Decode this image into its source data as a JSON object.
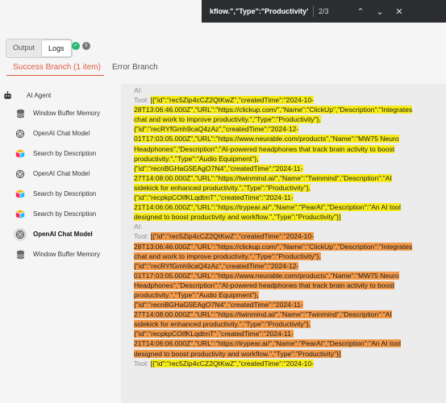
{
  "findbar": {
    "query": "kflow.\",\"Type\":\"Productivity\"}]",
    "count": "2/3",
    "prev_icon": "chevron-up-icon",
    "next_icon": "chevron-down-icon",
    "close_icon": "close-icon"
  },
  "toggle": {
    "output_label": "Output",
    "logs_label": "Logs"
  },
  "tabs": {
    "success_label": "Success Branch (1 item)",
    "error_label": "Error Branch"
  },
  "tree": {
    "root": "AI Agent",
    "items": [
      {
        "label": "Window Buffer Memory",
        "icon": "database-icon"
      },
      {
        "label": "OpenAI Chat Model",
        "icon": "openai-icon"
      },
      {
        "label": "Search by Description",
        "icon": "airtable-icon"
      },
      {
        "label": "OpenAI Chat Model",
        "icon": "openai-icon"
      },
      {
        "label": "Search by Description",
        "icon": "airtable-icon"
      },
      {
        "label": "Search by Description",
        "icon": "airtable-icon"
      },
      {
        "label": "OpenAI Chat Model",
        "icon": "openai-icon",
        "selected": true
      },
      {
        "label": "Window Buffer Memory",
        "icon": "database-icon"
      }
    ]
  },
  "log": {
    "blocks": [
      {
        "ai_label": "AI:",
        "tool_label": "Tool:",
        "lines": [
          "[{\"id\":\"rec5Zip4cCZ2QtKwZ\",\"createdTime\":\"2024-10-",
          "28T13:06:46.000Z\",\"URL\":\"https://clickup.com/\",\"Name\":\"ClickUp\",\"Description\":\"Integrates",
          "chat and work to improve productivity.\",\"Type\":\"Productivity\"},",
          "{\"id\":\"recRYfGmh9caQ4zAz\",\"createdTime\":\"2024-12-",
          "01T17:03:05.000Z\",\"URL\":\"https://www.neurable.com/products\",\"Name\":\"MW75 Neuro",
          "Headphones\",\"Description\":\"AI-powered headphones that track brain activity to boost",
          "productivity.\",\"Type\":\"Audio Equipment\"},",
          "{\"id\":\"recnBGHaG5EAgO7N4\",\"createdTime\":\"2024-11-",
          "27T14:08:00.000Z\",\"URL\":\"https://twinmind.ai/\",\"Name\":\"Twinmind\",\"Description\":\"AI",
          "sidekick for enhanced productivity.\",\"Type\":\"Productivity\"},",
          "{\"id\":\"recpkpCOIfKLqdtmT\",\"createdTime\":\"2024-11-",
          "21T14:06:06.000Z\",\"URL\":\"https://trypear.ai/\",\"Name\":\"PearAI\",\"Description\":\"An AI tool",
          "designed to boost productivity and workflow.\",\"Type\":\"Productivity\"}]"
        ]
      },
      {
        "ai_label": "AI:",
        "tool_label": "Tool:",
        "lines": [
          "[{\"id\":\"rec5Zip4cCZ2QtKwZ\",\"createdTime\":\"2024-10-",
          "28T13:06:46.000Z\",\"URL\":\"https://clickup.com/\",\"Name\":\"ClickUp\",\"Description\":\"Integrates",
          "chat and work to improve productivity.\",\"Type\":\"Productivity\"},",
          "{\"id\":\"recRYfGmh9caQ4zAz\",\"createdTime\":\"2024-12-",
          "01T17:03:05.000Z\",\"URL\":\"https://www.neurable.com/products\",\"Name\":\"MW75 Neuro",
          "Headphones\",\"Description\":\"AI-powered headphones that track brain activity to boost",
          "productivity.\",\"Type\":\"Audio Equipment\"},",
          "{\"id\":\"recnBGHaG5EAgO7N4\",\"createdTime\":\"2024-11-",
          "27T14:08:00.000Z\",\"URL\":\"https://twinmind.ai/\",\"Name\":\"Twinmind\",\"Description\":\"AI",
          "sidekick for enhanced productivity.\",\"Type\":\"Productivity\"},",
          "{\"id\":\"recpkpCOIfKLqdtmT\",\"createdTime\":\"2024-11-",
          "21T14:06:06.000Z\",\"URL\":\"https://trypear.ai/\",\"Name\":\"PearAI\",\"Description\":\"An AI tool",
          "designed to boost productivity and workflow.\",\"Type\":\"Productivity\"}]"
        ]
      },
      {
        "ai_label": "",
        "tool_label": "Tool:",
        "lines": [
          "[{\"id\":\"rec5Zip4cCZ2QtKwZ\",\"createdTime\":\"2024-10-"
        ]
      }
    ]
  },
  "colors": {
    "accent": "#e05a44",
    "highlight_match": "#f7ec1a",
    "highlight_current": "#f29a4a",
    "success": "#2bb673"
  }
}
